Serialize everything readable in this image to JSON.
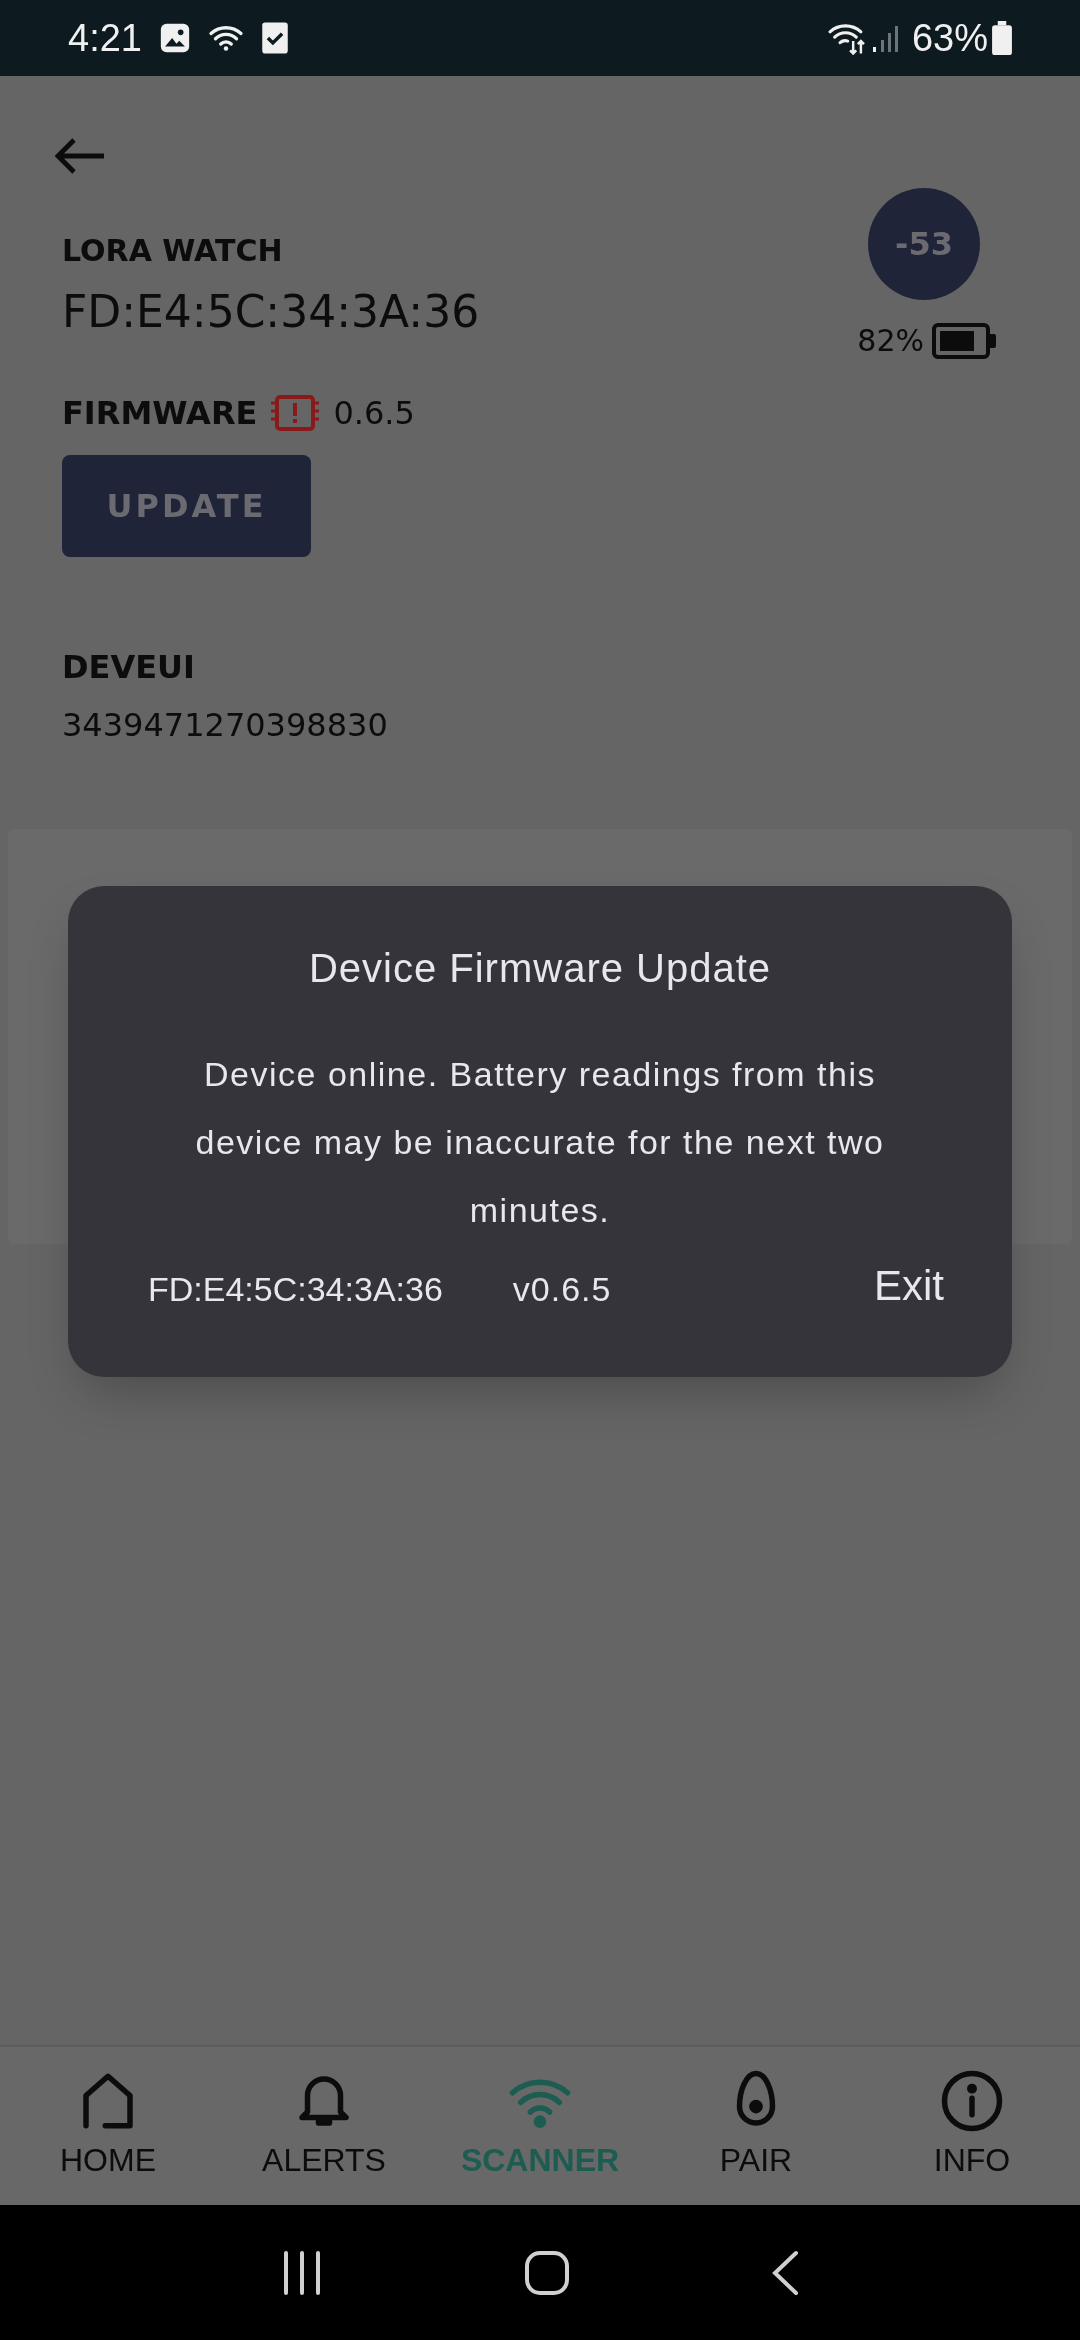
{
  "status_bar": {
    "time": "4:21",
    "battery": "63%"
  },
  "device": {
    "name": "LORA WATCH",
    "address": "FD:E4:5C:34:3A:36",
    "signal": "-53",
    "battery": "82%"
  },
  "firmware": {
    "label": "FIRMWARE",
    "version": "0.6.5",
    "update_button": "UPDATE"
  },
  "deveui": {
    "label": "DEVEUI",
    "value": "3439471270398830"
  },
  "dialog": {
    "title": "Device Firmware Update",
    "message": "Device online. Battery readings from this device may be inaccurate for the next two minutes.",
    "address": "FD:E4:5C:34:3A:36",
    "version": "v0.6.5",
    "exit_button": "Exit"
  },
  "tabs": [
    {
      "kind": "home",
      "label": "HOME",
      "selected": false
    },
    {
      "kind": "alerts",
      "label": "ALERTS",
      "selected": false
    },
    {
      "kind": "scanner",
      "label": "SCANNER",
      "selected": true
    },
    {
      "kind": "pair",
      "label": "PAIR",
      "selected": false
    },
    {
      "kind": "info",
      "label": "INFO",
      "selected": false
    }
  ]
}
